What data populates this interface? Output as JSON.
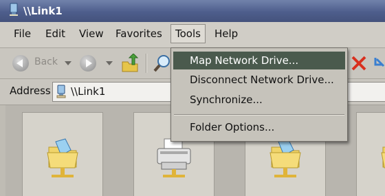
{
  "window": {
    "title": "\\\\Link1"
  },
  "menubar": {
    "items": [
      {
        "label": "File"
      },
      {
        "label": "Edit"
      },
      {
        "label": "View"
      },
      {
        "label": "Favorites"
      },
      {
        "label": "Tools"
      },
      {
        "label": "Help"
      }
    ],
    "active": "Tools"
  },
  "toolbar": {
    "back_label": "Back",
    "icons": [
      "back-arrow-icon",
      "forward-arrow-icon",
      "folder-up-icon",
      "search-icon",
      "delete-icon",
      "undo-icon"
    ]
  },
  "address": {
    "label": "Address",
    "value": "\\\\Link1"
  },
  "tools_menu": {
    "items": [
      {
        "label": "Map Network Drive...",
        "highlighted": true
      },
      {
        "label": "Disconnect Network Drive..."
      },
      {
        "label": "Synchronize..."
      },
      {
        "label": "Folder Options..."
      }
    ]
  },
  "content": {
    "items": [
      {
        "icon": "network-folder-icon"
      },
      {
        "icon": "network-printer-icon"
      },
      {
        "icon": "network-folder-icon"
      },
      {
        "icon": "network-folder-icon"
      }
    ]
  },
  "colors": {
    "titlebar": "#4e5e8c",
    "menu_highlight": "#4a5a4d",
    "window_bg": "#c9c6bf"
  }
}
